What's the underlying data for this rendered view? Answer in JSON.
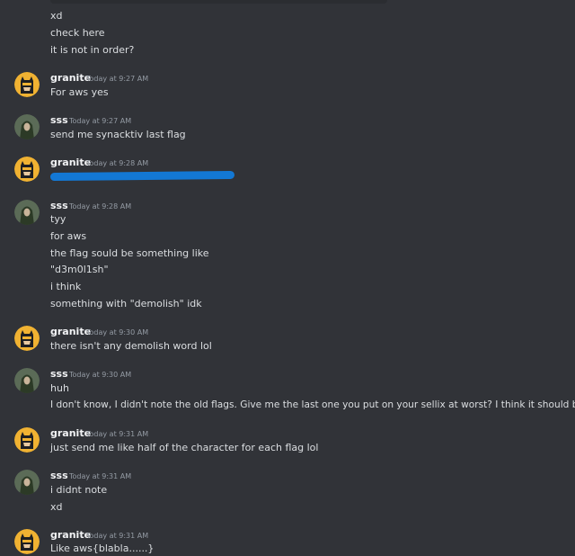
{
  "colors": {
    "background": "#313338",
    "text": "#dbdee1",
    "username": "#f2f3f5",
    "timestamp": "#949ba4",
    "redaction": "#1378d4",
    "granite_avatar_bg": "#f0b232",
    "sss_avatar_bg": "#5b6b57"
  },
  "lead_messages": [
    "xd",
    "check here",
    "it is not in order?"
  ],
  "groups": [
    {
      "author": "granite",
      "avatar": "batman-avatar-icon",
      "timestamp": "Today at 9:27 AM",
      "lines": [
        "For aws yes"
      ]
    },
    {
      "author": "sss",
      "avatar": "hooded-figure-avatar-icon",
      "timestamp": "Today at 9:27 AM",
      "lines": [
        "send me synacktiv last flag"
      ]
    },
    {
      "author": "granite",
      "avatar": "batman-avatar-icon",
      "timestamp": "Today at 9:28 AM",
      "lines": [],
      "redacted": true
    },
    {
      "author": "sss",
      "avatar": "hooded-figure-avatar-icon",
      "timestamp": "Today at 9:28 AM",
      "lines": [
        "tyy",
        "for aws",
        "the flag sould be something like",
        "\"d3m0l1sh\"",
        "i think",
        "something with \"demolish\" idk"
      ]
    },
    {
      "author": "granite",
      "avatar": "batman-avatar-icon",
      "timestamp": "Today at 9:30 AM",
      "lines": [
        "there isn't any demolish word lol"
      ]
    },
    {
      "author": "sss",
      "avatar": "hooded-figure-avatar-icon",
      "timestamp": "Today at 9:30 AM",
      "lines": [
        "huh",
        "I don't know, I didn't note the old flags. Give me the last one you put on your sellix at worst? I think it should be this one?"
      ]
    },
    {
      "author": "granite",
      "avatar": "batman-avatar-icon",
      "timestamp": "Today at 9:31 AM",
      "lines": [
        "just send me like half of the character for each flag lol"
      ]
    },
    {
      "author": "sss",
      "avatar": "hooded-figure-avatar-icon",
      "timestamp": "Today at 9:31 AM",
      "lines": [
        "i didnt note",
        "xd"
      ]
    },
    {
      "author": "granite",
      "avatar": "batman-avatar-icon",
      "timestamp": "Today at 9:31 AM",
      "lines": [
        "Like aws{blabla......}"
      ]
    }
  ]
}
